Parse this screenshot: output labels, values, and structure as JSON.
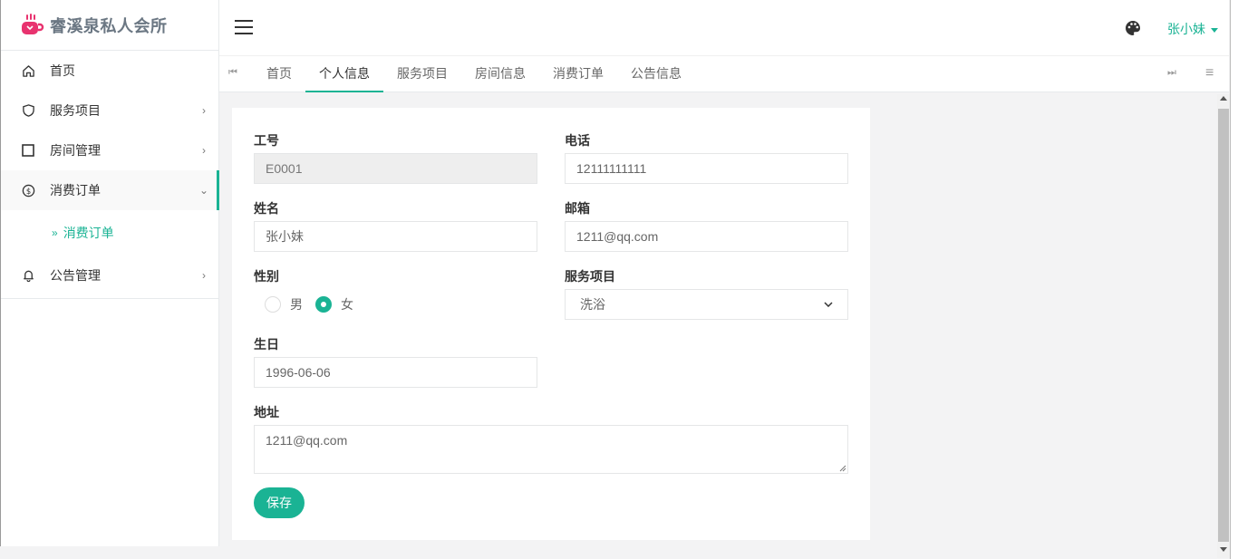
{
  "app": {
    "brand": "睿溪泉私人会所"
  },
  "sidebar": {
    "items": [
      {
        "label": "首页",
        "icon": "home-icon",
        "arrow": ""
      },
      {
        "label": "服务项目",
        "icon": "shield-icon",
        "arrow": "›"
      },
      {
        "label": "房间管理",
        "icon": "square-icon",
        "arrow": "›"
      },
      {
        "label": "消费订单",
        "icon": "dollar-circle-icon",
        "arrow": "⌄"
      },
      {
        "label": "公告管理",
        "icon": "bell-icon",
        "arrow": "›"
      }
    ],
    "sub_item": {
      "chevron": "»",
      "label": "消费订单"
    }
  },
  "header": {
    "user_name": "张小妹"
  },
  "tabs": {
    "left_nav": "⏮",
    "right_nav": "⏭",
    "menu": "≡",
    "items": [
      {
        "label": "首页"
      },
      {
        "label": "个人信息"
      },
      {
        "label": "服务项目"
      },
      {
        "label": "房间信息"
      },
      {
        "label": "消费订单"
      },
      {
        "label": "公告信息"
      }
    ]
  },
  "form": {
    "employee_id": {
      "label": "工号",
      "value": "E0001"
    },
    "phone": {
      "label": "电话",
      "value": "12111111111"
    },
    "name": {
      "label": "姓名",
      "value": "张小妹"
    },
    "email": {
      "label": "邮箱",
      "value": "1211@qq.com"
    },
    "gender": {
      "label": "性别",
      "male": "男",
      "female": "女",
      "selected": "女"
    },
    "service": {
      "label": "服务项目",
      "value": "洗浴"
    },
    "birthday": {
      "label": "生日",
      "value": "1996-06-06"
    },
    "address": {
      "label": "地址",
      "value": "1211@qq.com"
    },
    "save_label": "保存"
  },
  "colors": {
    "accent": "#1ab394",
    "logo": "#e8336f"
  }
}
